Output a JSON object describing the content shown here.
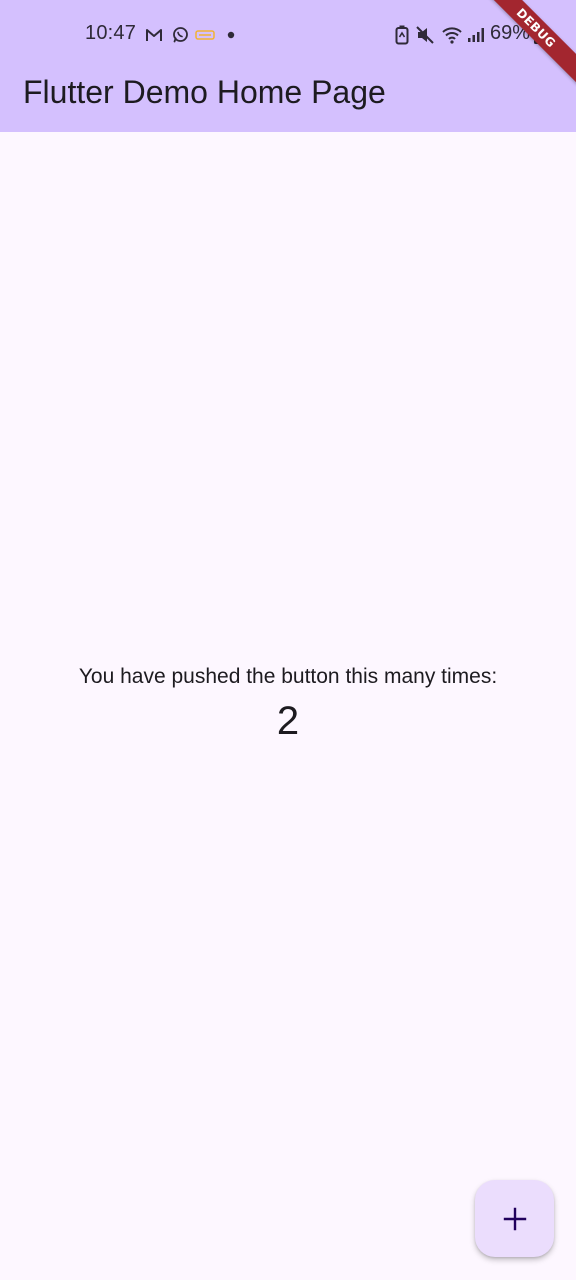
{
  "status_bar": {
    "time": "10:47",
    "battery_percent": "69%",
    "notification_icons": [
      "gmail-icon",
      "whatsapp-icon",
      "app-notification-icon",
      "dot-icon"
    ],
    "system_icons": [
      "battery-saver-icon",
      "mute-icon",
      "wifi-icon",
      "signal-icon",
      "battery-charging-icon"
    ]
  },
  "app_bar": {
    "title": "Flutter Demo Home Page",
    "background_color": "#d4c0fe"
  },
  "debug_banner": {
    "label": "DEBUG",
    "color": "#a3262f"
  },
  "body": {
    "counter_label": "You have pushed the button this many times:",
    "counter_value": "2",
    "background_color": "#fdf7ff"
  },
  "fab": {
    "icon": "add-icon",
    "background_color": "#ebddfd"
  }
}
